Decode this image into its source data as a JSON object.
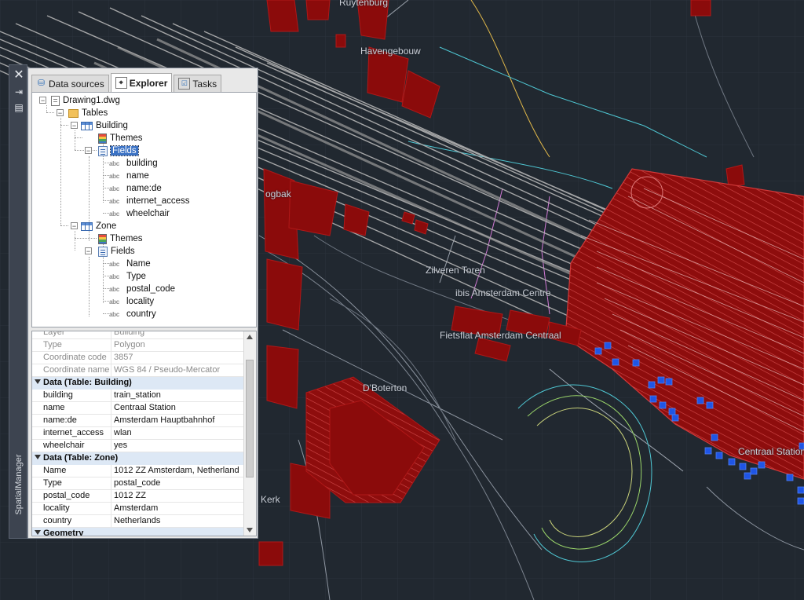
{
  "map": {
    "labels": [
      "Ruytenburg",
      "Havengebouw",
      "Zilveren Toren",
      "ibis Amsterdam Centre",
      "Fietsflat Amsterdam Centraal",
      "D'Boterton",
      "Centraal Station",
      "Kerk",
      "ogbak"
    ],
    "colors": {
      "background": "#212830",
      "building": "#8b0b0b",
      "building_edge": "#c21c1c",
      "rail": "#b4b4b4",
      "selection": "#1f55e6"
    }
  },
  "palette": {
    "title": "SpatialManager",
    "close_icon": "close-icon",
    "autohide_icon": "autohide-icon",
    "properties_icon": "properties-icon"
  },
  "tabs": [
    {
      "label": "Data sources",
      "icon": "database-icon",
      "active": false
    },
    {
      "label": "Explorer",
      "icon": "explorer-icon",
      "active": true
    },
    {
      "label": "Tasks",
      "icon": "tasks-icon",
      "active": false
    }
  ],
  "tree": {
    "root": "Drawing1.dwg",
    "tables": "Tables",
    "building": "Building",
    "building_themes": "Themes",
    "building_fields": "Fields",
    "building_field_items": [
      "building",
      "name",
      "name:de",
      "internet_access",
      "wheelchair"
    ],
    "zone": "Zone",
    "zone_themes": "Themes",
    "zone_fields": "Fields",
    "zone_field_items": [
      "Name",
      "Type",
      "postal_code",
      "locality",
      "country"
    ],
    "field_type_tag": "abc"
  },
  "properties": {
    "top_rows": [
      {
        "key": "Layer",
        "value": "Building"
      },
      {
        "key": "Type",
        "value": "Polygon"
      },
      {
        "key": "Coordinate code",
        "value": "3857"
      },
      {
        "key": "Coordinate name",
        "value": "WGS 84 / Pseudo-Mercator"
      }
    ],
    "cat_building": "Data (Table: Building)",
    "building_rows": [
      {
        "key": "building",
        "value": "train_station"
      },
      {
        "key": "name",
        "value": "Centraal Station"
      },
      {
        "key": "name:de",
        "value": "Amsterdam Hauptbahnhof"
      },
      {
        "key": "internet_access",
        "value": "wlan"
      },
      {
        "key": "wheelchair",
        "value": "yes"
      }
    ],
    "cat_zone": "Data (Table: Zone)",
    "zone_rows": [
      {
        "key": "Name",
        "value": "1012 ZZ Amsterdam, Netherland"
      },
      {
        "key": "Type",
        "value": "postal_code"
      },
      {
        "key": "postal_code",
        "value": "1012 ZZ"
      },
      {
        "key": "locality",
        "value": "Amsterdam"
      },
      {
        "key": "country",
        "value": "Netherlands"
      }
    ],
    "cat_geometry": "Geometry"
  }
}
